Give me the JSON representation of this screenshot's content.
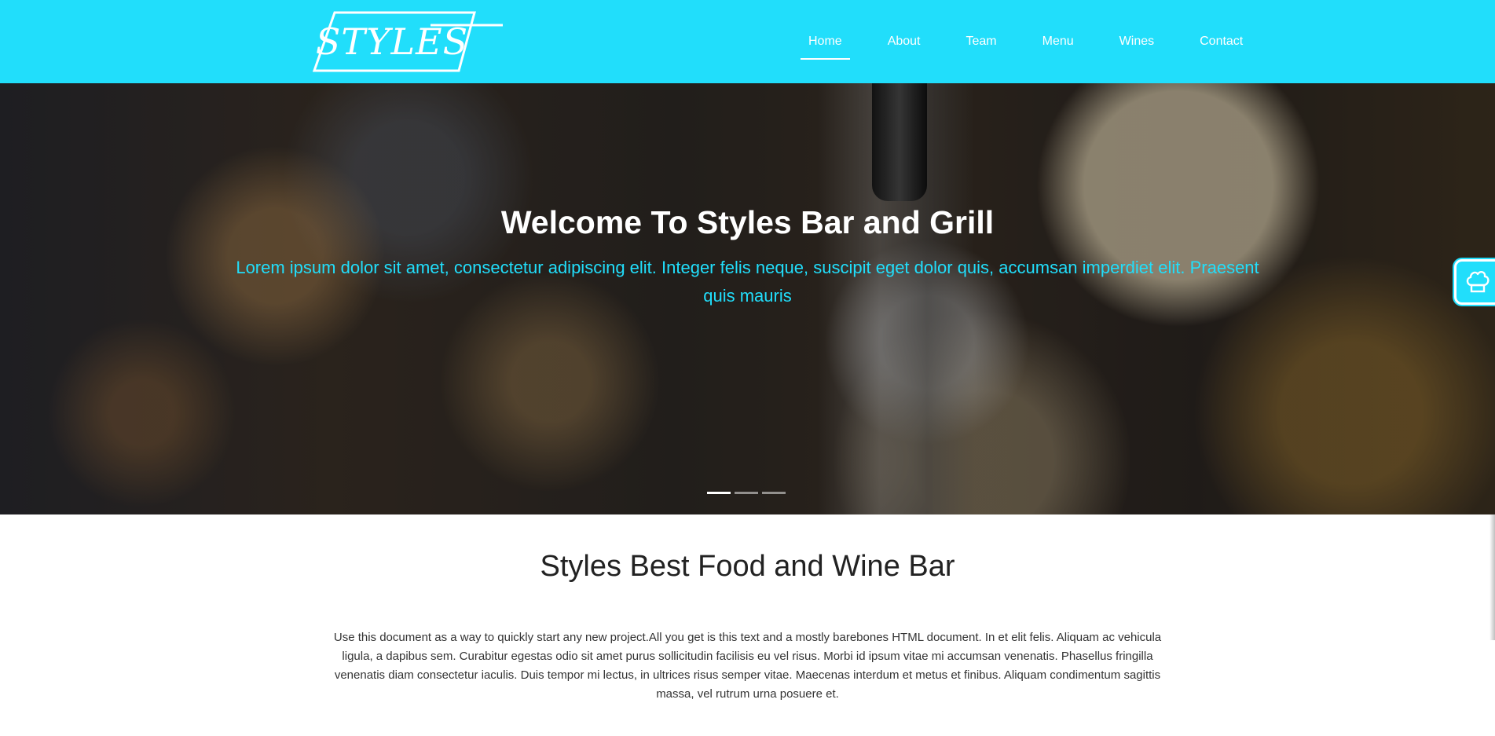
{
  "brand": {
    "logo_text": "STYLES"
  },
  "nav": {
    "items": [
      {
        "label": "Home",
        "active": true
      },
      {
        "label": "About",
        "active": false
      },
      {
        "label": "Team",
        "active": false
      },
      {
        "label": "Menu",
        "active": false
      },
      {
        "label": "Wines",
        "active": false
      },
      {
        "label": "Contact",
        "active": false
      }
    ]
  },
  "hero": {
    "title": "Welcome To Styles Bar and Grill",
    "subtitle": "Lorem ipsum dolor sit amet, consectetur adipiscing elit. Integer felis neque, suscipit eget dolor quis, accumsan imperdiet elit. Praesent quis mauris",
    "slide_count": 3,
    "active_slide": 1
  },
  "floating_button": {
    "icon": "chef-hat-icon"
  },
  "about": {
    "title": "Styles Best Food and Wine Bar",
    "text": "Use this document as a way to quickly start any new project.All you get is this text and a mostly barebones HTML document. In et elit felis. Aliquam ac vehicula ligula, a dapibus sem. Curabitur egestas odio sit amet purus sollicitudin facilisis eu vel risus. Morbi id ipsum vitae mi accumsan venenatis. Phasellus fringilla venenatis diam consectetur iaculis. Duis tempor mi lectus, in ultrices risus semper vitae. Maecenas interdum et metus et finibus. Aliquam condimentum sagittis massa, vel rutrum urna posuere et."
  },
  "colors": {
    "brand_cyan": "#21defb",
    "text_dark": "#222222"
  }
}
